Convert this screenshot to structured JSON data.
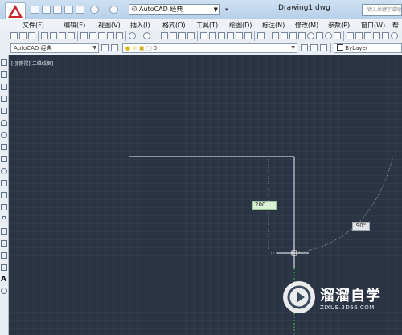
{
  "titlebar": {
    "workspace": "AutoCAD 经典",
    "document_title": "Drawing1.dwg",
    "search_placeholder": "键入关键字或短语"
  },
  "menu": [
    "文件(F)",
    "编辑(E)",
    "视图(V)",
    "插入(I)",
    "格式(O)",
    "工具(T)",
    "绘图(D)",
    "标注(N)",
    "修改(M)",
    "参数(P)",
    "窗口(W)",
    "帮"
  ],
  "toolbar2": {
    "workspace_combo": "AutoCAD 经典",
    "layer_combo": "0",
    "linetype_combo": "ByLayer"
  },
  "canvas": {
    "viewport_label": "[-][俯视][二维线框]",
    "dynamic_input_value": "200",
    "angle_tooltip": "90°"
  },
  "watermark": {
    "title": "溜溜自学",
    "url": "ZIXUE.3D66.COM"
  },
  "colors": {
    "canvas_bg": "#2b3444",
    "line": "#f2f2f2",
    "tracking_green": "#3fbf3f",
    "logo_red": "#c8262b"
  }
}
